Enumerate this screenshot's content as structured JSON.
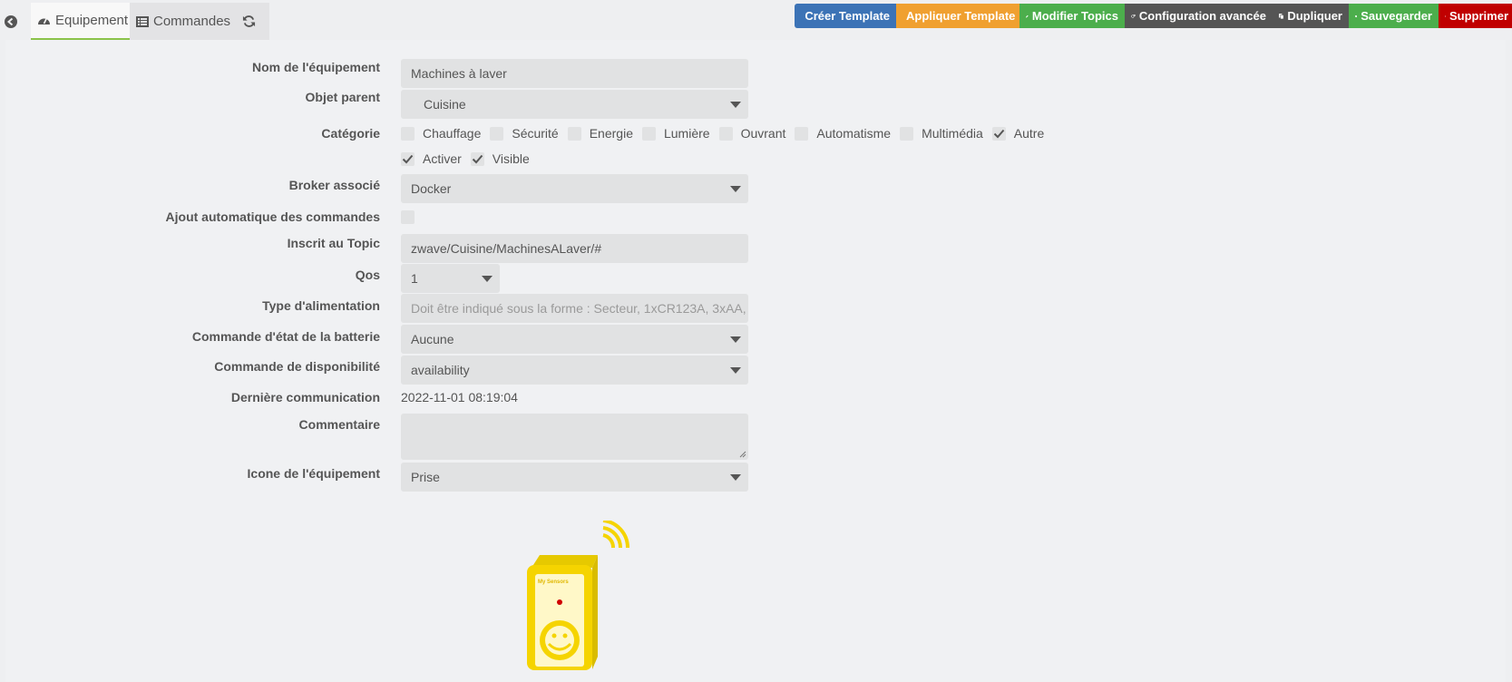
{
  "tabs": {
    "back_icon": "arrow-circle-left-icon",
    "equipment_label": "Equipement",
    "commands_label": "Commandes",
    "refresh_icon": "refresh-icon"
  },
  "actions": [
    {
      "label": "Créer Template",
      "color": "#3c73b6",
      "icon": "cubes-icon"
    },
    {
      "label": "Appliquer Template",
      "color": "#f0a030",
      "icon": "share-icon"
    },
    {
      "label": "Modifier Topics",
      "color": "#4cae4c",
      "icon": "pencil-icon"
    },
    {
      "label": "Configuration avancée",
      "color": "#555555",
      "icon": "cogs-icon"
    },
    {
      "label": "Dupliquer",
      "color": "#555555",
      "icon": "copy-icon"
    },
    {
      "label": "Sauvegarder",
      "color": "#4cae4c",
      "icon": "check-circle-icon"
    },
    {
      "label": "Supprimer",
      "color": "#c00000",
      "icon": "minus-circle-icon"
    }
  ],
  "form": {
    "name": {
      "label": "Nom de l'équipement",
      "value": "Machines à laver"
    },
    "parent": {
      "label": "Objet parent",
      "value": "Cuisine"
    },
    "category": {
      "label": "Catégorie",
      "options": [
        {
          "label": "Chauffage",
          "checked": false
        },
        {
          "label": "Sécurité",
          "checked": false
        },
        {
          "label": "Energie",
          "checked": false
        },
        {
          "label": "Lumière",
          "checked": false
        },
        {
          "label": "Ouvrant",
          "checked": false
        },
        {
          "label": "Automatisme",
          "checked": false
        },
        {
          "label": "Multimédia",
          "checked": false
        },
        {
          "label": "Autre",
          "checked": true
        }
      ]
    },
    "enable": {
      "label": "Activer",
      "checked": true
    },
    "visible": {
      "label": "Visible",
      "checked": true
    },
    "broker": {
      "label": "Broker associé",
      "value": "Docker"
    },
    "auto_add": {
      "label": "Ajout automatique des commandes",
      "checked": false
    },
    "topic": {
      "label": "Inscrit au Topic",
      "value": "zwave/Cuisine/MachinesALaver/#"
    },
    "qos": {
      "label": "Qos",
      "value": "1"
    },
    "power": {
      "label": "Type d'alimentation",
      "placeholder": "Doit être indiqué sous la forme : Secteur, 1xCR123A, 3xAA,"
    },
    "battery": {
      "label": "Commande d'état de la batterie",
      "value": "Aucune"
    },
    "availability": {
      "label": "Commande de disponibilité",
      "value": "availability"
    },
    "last_comm": {
      "label": "Dernière communication",
      "value": "2022-11-01 08:19:04"
    },
    "comment": {
      "label": "Commentaire",
      "value": ""
    },
    "icon": {
      "label": "Icone de l'équipement",
      "value": "Prise"
    }
  },
  "device_image": {
    "brand_text": "My Sensors",
    "color": "#f5d400",
    "icon": "smart-plug-icon"
  }
}
